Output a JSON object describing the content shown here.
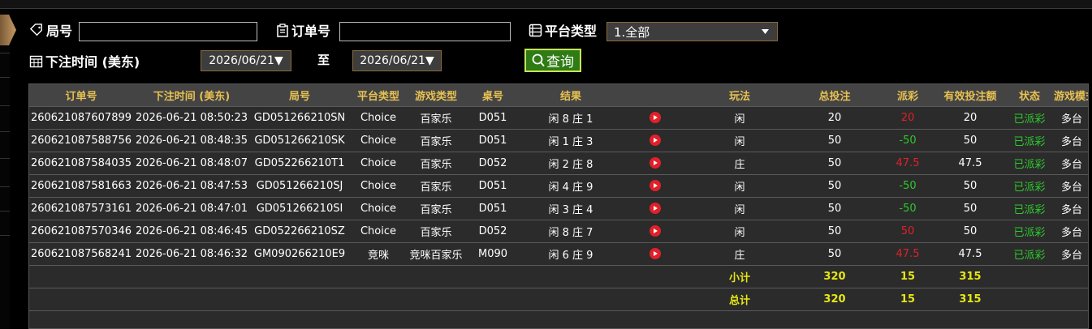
{
  "filters": {
    "round_label": "局号",
    "round_value": "",
    "order_label": "订单号",
    "order_value": "",
    "platform_label": "平台类型",
    "platform_selected": "1.全部",
    "bet_time_label": "下注时间 (美东)",
    "date_from": "2026/06/21▼",
    "to_label": "至",
    "date_to": "2026/06/21▼",
    "search_label": "查询"
  },
  "table": {
    "columns": [
      "订单号",
      "下注时间 (美东)",
      "局号",
      "平台类型",
      "游戏类型",
      "桌号",
      "结果",
      "",
      "玩法",
      "总投注",
      "派彩",
      "有效投注额",
      "状态",
      "游戏模式"
    ],
    "rows": [
      {
        "order": "260621087607899",
        "time": "2026-06-21 08:50:23",
        "round": "GD051266210SN",
        "platform": "Choice",
        "game": "百家乐",
        "table": "D051",
        "result": "闲 8 庄 1",
        "play": "闲",
        "bet": "20",
        "payout": "20",
        "payout_color": "red",
        "valid": "20",
        "status": "已派彩",
        "mode": "多台"
      },
      {
        "order": "260621087588756",
        "time": "2026-06-21 08:48:35",
        "round": "GD051266210SK",
        "platform": "Choice",
        "game": "百家乐",
        "table": "D051",
        "result": "闲 1 庄 3",
        "play": "闲",
        "bet": "50",
        "payout": "-50",
        "payout_color": "green",
        "valid": "50",
        "status": "已派彩",
        "mode": "多台"
      },
      {
        "order": "260621087584035",
        "time": "2026-06-21 08:48:07",
        "round": "GD052266210T1",
        "platform": "Choice",
        "game": "百家乐",
        "table": "D052",
        "result": "闲 2 庄 8",
        "play": "庄",
        "bet": "50",
        "payout": "47.5",
        "payout_color": "red",
        "valid": "47.5",
        "status": "已派彩",
        "mode": "多台"
      },
      {
        "order": "260621087581663",
        "time": "2026-06-21 08:47:53",
        "round": "GD051266210SJ",
        "platform": "Choice",
        "game": "百家乐",
        "table": "D051",
        "result": "闲 4 庄 9",
        "play": "闲",
        "bet": "50",
        "payout": "-50",
        "payout_color": "green",
        "valid": "50",
        "status": "已派彩",
        "mode": "多台"
      },
      {
        "order": "260621087573161",
        "time": "2026-06-21 08:47:01",
        "round": "GD051266210SI",
        "platform": "Choice",
        "game": "百家乐",
        "table": "D051",
        "result": "闲 3 庄 4",
        "play": "闲",
        "bet": "50",
        "payout": "-50",
        "payout_color": "green",
        "valid": "50",
        "status": "已派彩",
        "mode": "多台"
      },
      {
        "order": "260621087570346",
        "time": "2026-06-21 08:46:45",
        "round": "GD052266210SZ",
        "platform": "Choice",
        "game": "百家乐",
        "table": "D052",
        "result": "闲 8 庄 7",
        "play": "闲",
        "bet": "50",
        "payout": "50",
        "payout_color": "red",
        "valid": "50",
        "status": "已派彩",
        "mode": "多台"
      },
      {
        "order": "260621087568241",
        "time": "2026-06-21 08:46:32",
        "round": "GM090266210E9",
        "platform": "竞咪",
        "game": "竞咪百家乐",
        "table": "M090",
        "result": "闲 6 庄 9",
        "play": "庄",
        "bet": "50",
        "payout": "47.5",
        "payout_color": "red",
        "valid": "47.5",
        "status": "已派彩",
        "mode": "多台"
      }
    ],
    "subtotal": {
      "label": "小计",
      "bet": "320",
      "payout": "15",
      "valid": "315"
    },
    "total": {
      "label": "总计",
      "bet": "320",
      "payout": "15",
      "valid": "315"
    }
  },
  "colors": {
    "header_text": "#e7c152",
    "positive_payout": "#e0202a",
    "negative_payout": "#2ec82e",
    "status_text": "#2ec82e",
    "summary_text": "#e6e614",
    "search_button": "#2f7b14"
  }
}
